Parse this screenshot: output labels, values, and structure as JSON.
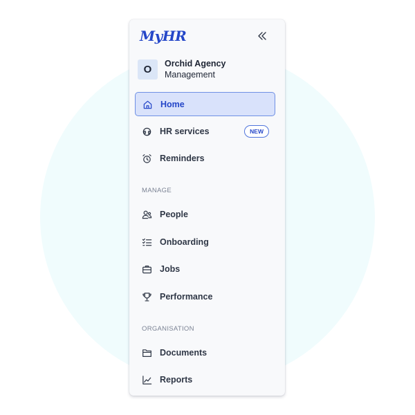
{
  "app": {
    "logo_text": "MyHR"
  },
  "header": {
    "collapse_icon": "double-chevron-left-icon"
  },
  "org": {
    "avatar_letter": "O",
    "name": "Orchid Agency",
    "role": "Management"
  },
  "nav": {
    "top": [
      {
        "label": "Home",
        "icon": "home-icon",
        "active": true
      },
      {
        "label": "HR services",
        "icon": "support-headset-icon",
        "badge": "NEW"
      },
      {
        "label": "Reminders",
        "icon": "alarm-clock-icon"
      }
    ],
    "manage_heading": "MANAGE",
    "manage": [
      {
        "label": "People",
        "icon": "people-icon"
      },
      {
        "label": "Onboarding",
        "icon": "checklist-icon"
      },
      {
        "label": "Jobs",
        "icon": "briefcase-icon"
      },
      {
        "label": "Performance",
        "icon": "trophy-icon"
      }
    ],
    "org_heading": "ORGANISATION",
    "organisation": [
      {
        "label": "Documents",
        "icon": "folder-icon"
      },
      {
        "label": "Reports",
        "icon": "line-chart-icon"
      }
    ]
  },
  "colors": {
    "accent": "#2446c8",
    "active_bg": "#d9e2fb",
    "active_border": "#6e8fe4",
    "page_circle": "#f0fcfd"
  }
}
